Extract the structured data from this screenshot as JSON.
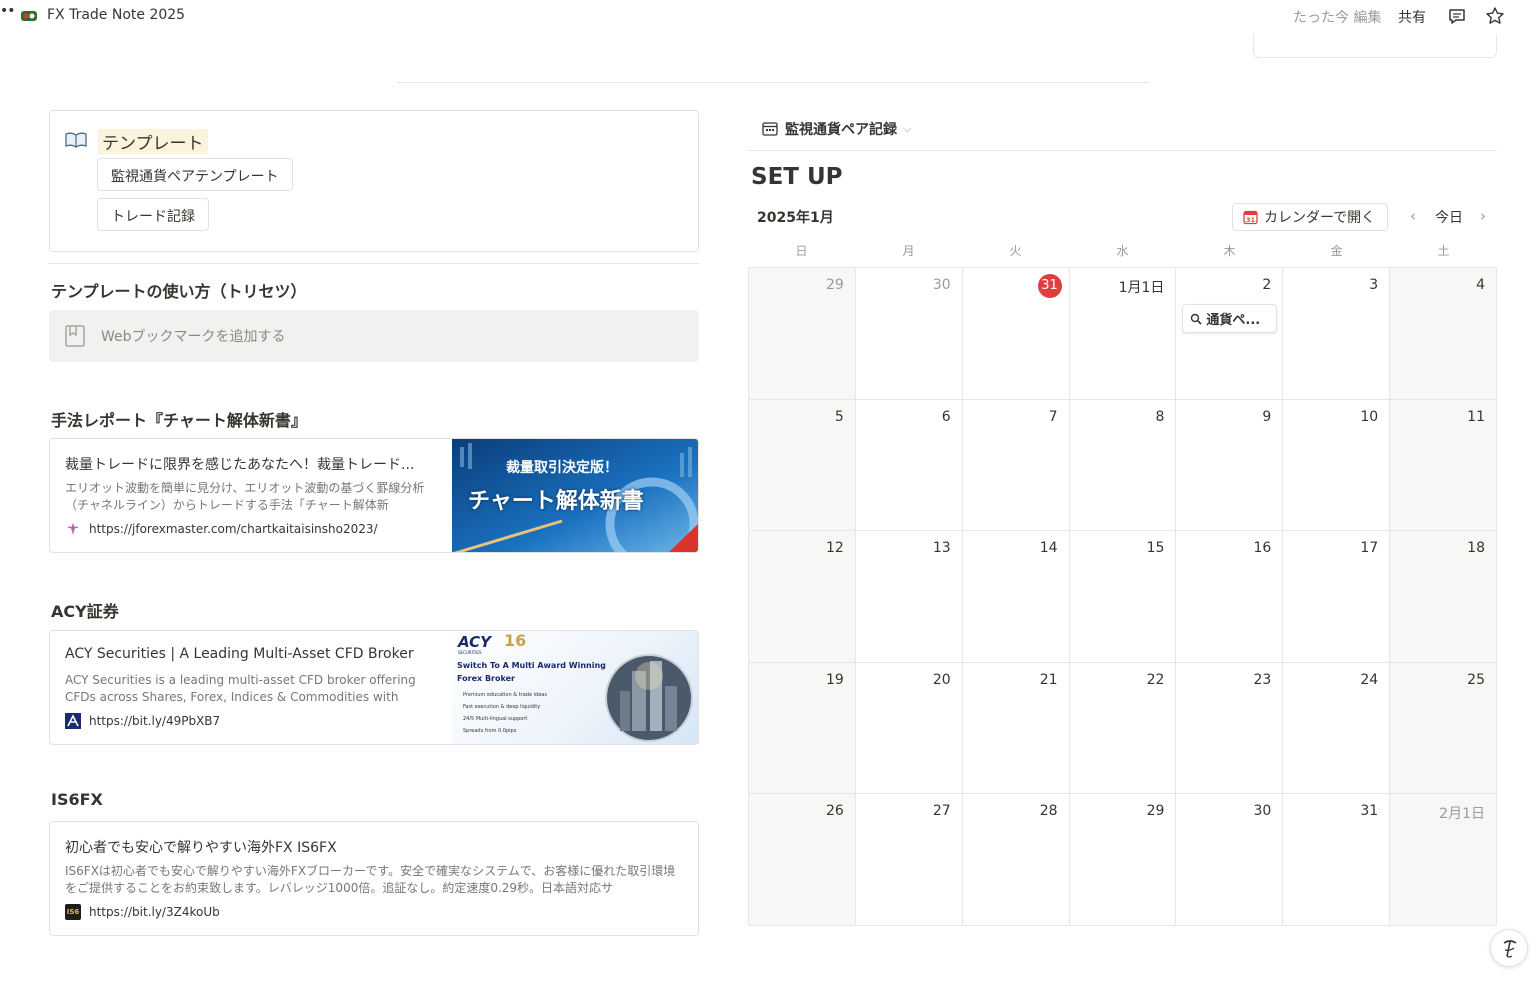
{
  "topbar": {
    "title": "FX Trade Note 2025",
    "edited": "たった今 編集",
    "share": "共有",
    "more": "••"
  },
  "template": {
    "title": "テンプレート",
    "buttons": [
      "監視通貨ペアテンプレート",
      "トレード記録"
    ]
  },
  "howto": {
    "heading": "テンプレートの使い方（トリセツ）",
    "web_bookmark_label": "Webブックマークを追加する"
  },
  "report": {
    "heading": "手法レポート『チャート解体新書』",
    "bookmark": {
      "title": "裁量トレードに限界を感じたあなたへ！裁量トレード...",
      "description": "エリオット波動を簡単に見分け、エリオット波動の基づく罫線分析（チャネルライン）からトレードする手法「チャート解体新",
      "url": "https://jforexmaster.com/chartkaitaisinsho2023/",
      "thumb_line1": "裁量取引決定版！",
      "thumb_line2": "チャート解体新書"
    }
  },
  "acy": {
    "heading": "ACY証券",
    "bookmark": {
      "title": "ACY Securities | A Leading Multi-Asset CFD Broker",
      "description": "ACY Securities is a leading multi-asset CFD broker offering CFDs across Shares, Forex, Indices & Commodities with",
      "url": "https://bit.ly/49PbXB7",
      "thumb_brand": "ACY",
      "thumb_brand_sub": "SECURITIES",
      "thumb_badge": "16",
      "thumb_headline": "Switch To A Multi Award Winning Forex Broker",
      "thumb_bullets": [
        "Premium education & trade ideas",
        "Fast execution & deep liquidity",
        "24/5 Multi-lingual support",
        "Spreads from 0.0pips"
      ]
    }
  },
  "is6fx": {
    "heading": "IS6FX",
    "bookmark": {
      "title": "初心者でも安心で解りやすい海外FX IS6FX",
      "description": "IS6FXは初心者でも安心で解りやすい海外FXブローカーです。安全で確実なシステムで、お客様に優れた取引環境をご提供することをお約束致します。レバレッジ1000倍。追証なし。約定速度0.29秒。日本語対応サ",
      "url": "https://bit.ly/3Z4koUb",
      "favicon_text": "IS6"
    }
  },
  "database": {
    "title": "監視通貨ペア記録",
    "view_title": "SET UP",
    "month": "2025年1月",
    "open_calendar": "カレンダーで開く",
    "today": "今日",
    "weekdays": [
      "日",
      "月",
      "火",
      "水",
      "木",
      "金",
      "土"
    ],
    "days": [
      "29",
      "30",
      "31",
      "1月1日",
      "2",
      "3",
      "4",
      "5",
      "6",
      "7",
      "8",
      "9",
      "10",
      "11",
      "12",
      "13",
      "14",
      "15",
      "16",
      "17",
      "18",
      "19",
      "20",
      "21",
      "22",
      "23",
      "24",
      "25",
      "26",
      "27",
      "28",
      "29",
      "30",
      "31",
      "2月1日"
    ],
    "event": {
      "label": "通貨ペ..."
    }
  },
  "colors": {
    "today_red": "#e03e3e",
    "highlight_yellow": "#fbf3db",
    "weekend_bg": "#f7f7f5"
  }
}
